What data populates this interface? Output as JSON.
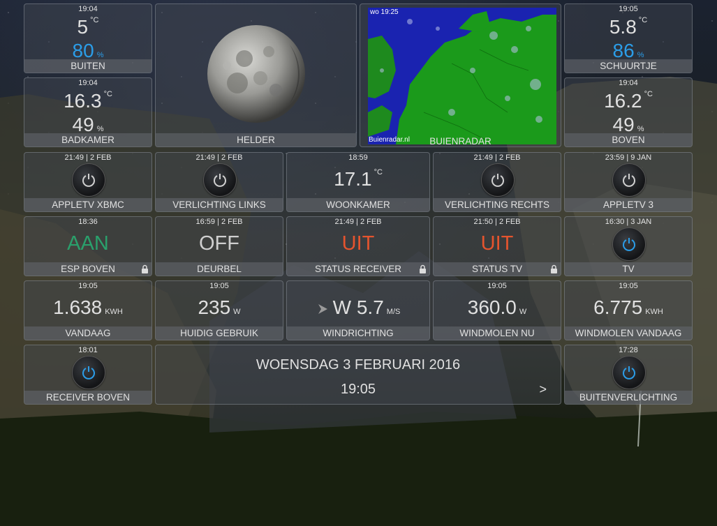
{
  "colors": {
    "accent_blue": "#2b9de8",
    "on_green": "#2aa06c",
    "uit_red": "#e5542e",
    "off_grey": "#cfcfcf"
  },
  "buiten": {
    "time": "19:04",
    "temp": "5",
    "temp_unit": "°C",
    "hum": "80",
    "hum_unit": "%",
    "label": "BUITEN"
  },
  "badkamer": {
    "time": "19:04",
    "temp": "16.3",
    "temp_unit": "°C",
    "hum": "49",
    "hum_unit": "%",
    "label": "BADKAMER"
  },
  "moon": {
    "label": "HELDER"
  },
  "radar": {
    "timestamp": "wo 19:25",
    "watermark": "Buienradar.nl",
    "label": "BUIENRADAR"
  },
  "schuurtje": {
    "time": "19:05",
    "temp": "5.8",
    "temp_unit": "°C",
    "hum": "86",
    "hum_unit": "%",
    "label": "SCHUURTJE"
  },
  "boven": {
    "time": "19:04",
    "temp": "16.2",
    "temp_unit": "°C",
    "hum": "49",
    "hum_unit": "%",
    "label": "BOVEN"
  },
  "appletv_xbmc": {
    "time": "21:49 | 2 FEB",
    "label": "APPLETV XBMC",
    "icon": "power-icon"
  },
  "verlichting_links": {
    "time": "21:49 | 2 FEB",
    "label": "VERLICHTING LINKS",
    "icon": "power-icon"
  },
  "woonkamer": {
    "time": "18:59",
    "temp": "17.1",
    "temp_unit": "°C",
    "label": "WOONKAMER"
  },
  "verlichting_rechts": {
    "time": "21:49 | 2 FEB",
    "label": "VERLICHTING RECHTS",
    "icon": "power-icon"
  },
  "appletv3": {
    "time": "23:59 | 9 JAN",
    "label": "APPLETV 3",
    "icon": "power-icon"
  },
  "esp_boven": {
    "time": "18:36",
    "state": "AAN",
    "label": "ESP BOVEN"
  },
  "deurbel": {
    "time": "16:59 | 2 FEB",
    "state": "OFF",
    "label": "DEURBEL"
  },
  "status_receiver": {
    "time": "21:49 | 2 FEB",
    "state": "UIT",
    "label": "STATUS RECEIVER"
  },
  "status_tv": {
    "time": "21:50 | 2 FEB",
    "state": "UIT",
    "label": "STATUS TV"
  },
  "tv": {
    "time": "16:30 | 3 JAN",
    "label": "TV",
    "icon": "power-icon"
  },
  "vandaag": {
    "time": "19:05",
    "value": "1.638",
    "unit": "KWH",
    "label": "VANDAAG"
  },
  "huidig_gebruik": {
    "time": "19:05",
    "value": "235",
    "unit": "W",
    "label": "HUIDIG GEBRUIK"
  },
  "windrichting": {
    "value": "W 5.7",
    "unit": "M/S",
    "label": "WINDRICHTING"
  },
  "windmolen_nu": {
    "time": "19:05",
    "value": "360.0",
    "unit": "W",
    "label": "WINDMOLEN NU"
  },
  "windmolen_vandaag": {
    "time": "19:05",
    "value": "6.775",
    "unit": "KWH",
    "label": "WINDMOLEN VANDAAG"
  },
  "receiver_boven": {
    "time": "18:01",
    "label": "RECEIVER BOVEN",
    "icon": "power-icon"
  },
  "datetime": {
    "date": "WOENSDAG 3 FEBRUARI 2016",
    "time": "19:05",
    "next": ">"
  },
  "buitenverlichting": {
    "time": "17:28",
    "label": "BUITENVERLICHTING",
    "icon": "power-icon"
  }
}
